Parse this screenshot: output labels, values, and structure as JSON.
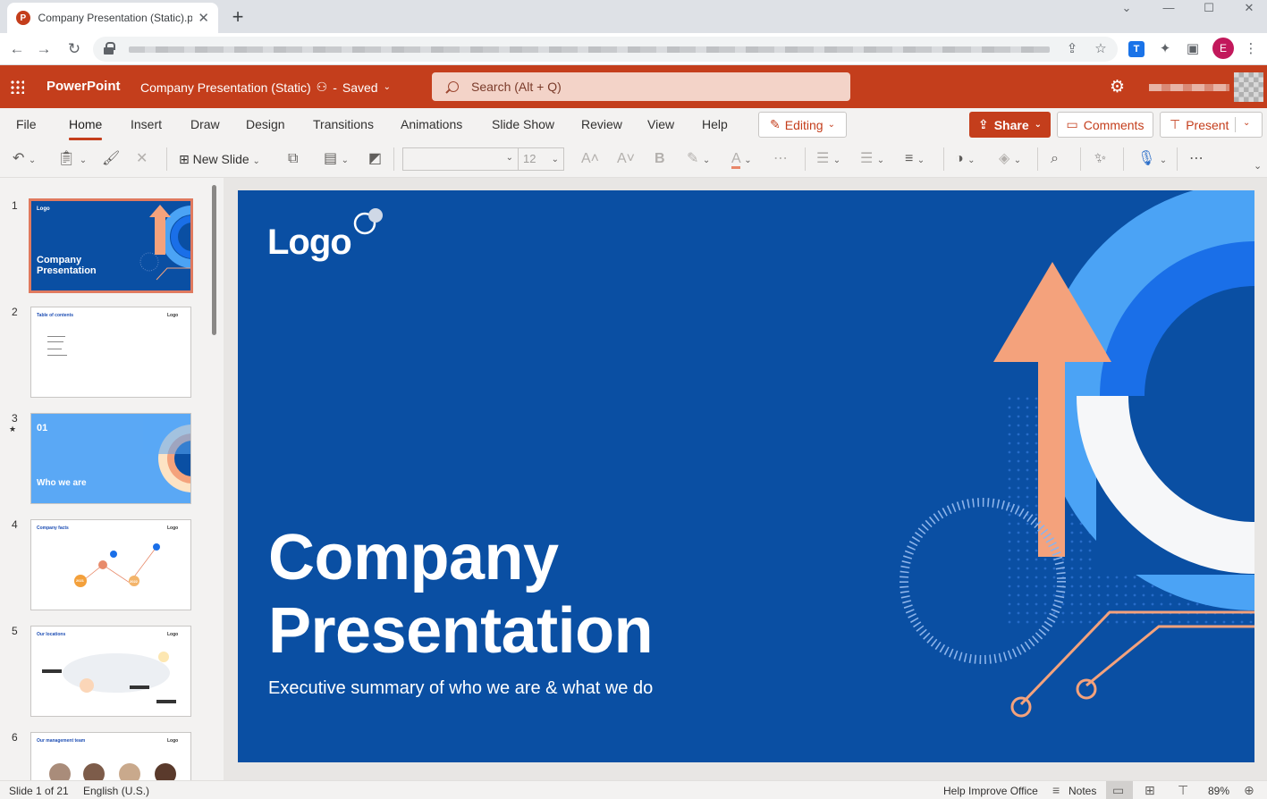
{
  "browser": {
    "tab_title": "Company Presentation (Static).pp",
    "tab_favicon": "P",
    "new_tab": "+",
    "window": {
      "minimize": "—",
      "restore": "☐",
      "close": "✕"
    },
    "profile_initial": "E",
    "extension_label": "T"
  },
  "header": {
    "app_name": "PowerPoint",
    "doc_title": "Company Presentation (Static)",
    "status": "Saved",
    "search_placeholder": "Search (Alt + Q)",
    "brand_color": "#c43e1c"
  },
  "ribbon": {
    "tabs": [
      "File",
      "Home",
      "Insert",
      "Draw",
      "Design",
      "Transitions",
      "Animations",
      "Slide Show",
      "Review",
      "View",
      "Help"
    ],
    "active_tab": "Home",
    "editing_label": "Editing",
    "share_label": "Share",
    "comments_label": "Comments",
    "present_label": "Present",
    "new_slide_label": "New Slide",
    "font_size": "12"
  },
  "thumbnails": [
    {
      "number": "1",
      "title": "Company Presentation",
      "logo": "Logo",
      "selected": true
    },
    {
      "number": "2",
      "title": "Table of contents",
      "logo": "Logo"
    },
    {
      "number": "3",
      "title": "Who we are",
      "section": "01"
    },
    {
      "number": "4",
      "title": "Company facts",
      "logo": "Logo",
      "markers": [
        "2021",
        "2022"
      ]
    },
    {
      "number": "5",
      "title": "Our locations",
      "logo": "Logo"
    },
    {
      "number": "6",
      "title": "Our management team",
      "logo": "Logo"
    }
  ],
  "slide": {
    "logo": "Logo",
    "title_line1": "Company",
    "title_line2": "Presentation",
    "subtitle": "Executive summary of who we are & what we do",
    "background_color": "#0a4fa3",
    "accent_orange": "#f4a27c",
    "accent_light_blue": "#4ba3f5",
    "accent_blue": "#1a6fe8"
  },
  "statusbar": {
    "slide_info": "Slide 1 of 21",
    "language": "English (U.S.)",
    "help": "Help Improve Office",
    "notes": "Notes",
    "zoom": "89%"
  }
}
